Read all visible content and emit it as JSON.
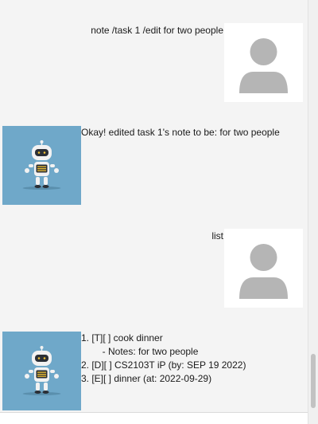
{
  "chat": {
    "messages": [
      {
        "sender": "user",
        "text": "note /task 1 /edit for two people",
        "avatar_icon": "user-placeholder-icon"
      },
      {
        "sender": "bot",
        "text": "Okay! edited task 1's note to be: for two people",
        "avatar_icon": "robot-icon"
      },
      {
        "sender": "user",
        "text": "list",
        "avatar_icon": "user-placeholder-icon"
      },
      {
        "sender": "bot",
        "lines": [
          "1. [T][ ] cook dinner",
          "        - Notes: for two people",
          "2. [D][ ] CS2103T iP (by: SEP 19 2022)",
          "3. [E][ ] dinner (at: 2022-09-29)"
        ],
        "avatar_icon": "robot-icon"
      }
    ]
  },
  "scrollbar": {
    "position_fraction": 0.94
  },
  "colors": {
    "chat_background": "#f4f4f4",
    "bot_avatar_background": "#6fa8c9",
    "user_avatar_glyph": "#b5b5b5",
    "text": "#1a1a1a"
  }
}
